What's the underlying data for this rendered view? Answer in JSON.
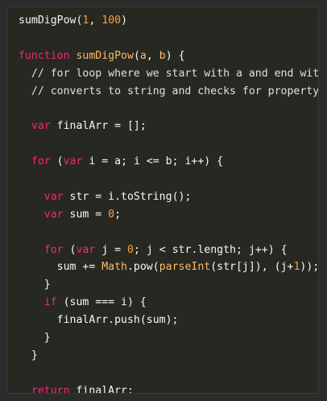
{
  "editor": {
    "colors": {
      "background": "#272822",
      "text": "#f8f8f2",
      "keyword": "#f92672",
      "function": "#ffb86c",
      "number": "#ff9d3c"
    },
    "lines": [
      [
        {
          "t": "sumDigPow(",
          "c": "plain"
        },
        {
          "t": "1",
          "c": "num"
        },
        {
          "t": ", ",
          "c": "plain"
        },
        {
          "t": "100",
          "c": "num"
        },
        {
          "t": ")",
          "c": "plain"
        }
      ],
      [],
      [
        {
          "t": "function ",
          "c": "kw"
        },
        {
          "t": "sumDigPow",
          "c": "fn"
        },
        {
          "t": "(",
          "c": "plain"
        },
        {
          "t": "a",
          "c": "fn"
        },
        {
          "t": ", ",
          "c": "plain"
        },
        {
          "t": "b",
          "c": "fn"
        },
        {
          "t": ") {",
          "c": "plain"
        }
      ],
      [
        {
          "t": "  // for loop where we start with a and end with b",
          "c": "cm"
        }
      ],
      [
        {
          "t": "  // converts to string and checks for property",
          "c": "cm"
        }
      ],
      [],
      [
        {
          "t": "  ",
          "c": "plain"
        },
        {
          "t": "var",
          "c": "kw"
        },
        {
          "t": " finalArr = [];",
          "c": "plain"
        }
      ],
      [],
      [
        {
          "t": "  ",
          "c": "plain"
        },
        {
          "t": "for",
          "c": "kw"
        },
        {
          "t": " (",
          "c": "plain"
        },
        {
          "t": "var",
          "c": "kw"
        },
        {
          "t": " i = a; i <= b; i++) {",
          "c": "plain"
        }
      ],
      [],
      [
        {
          "t": "    ",
          "c": "plain"
        },
        {
          "t": "var",
          "c": "kw"
        },
        {
          "t": " str = i.toString();",
          "c": "plain"
        }
      ],
      [
        {
          "t": "    ",
          "c": "plain"
        },
        {
          "t": "var",
          "c": "kw"
        },
        {
          "t": " sum = ",
          "c": "plain"
        },
        {
          "t": "0",
          "c": "num"
        },
        {
          "t": ";",
          "c": "plain"
        }
      ],
      [],
      [
        {
          "t": "    ",
          "c": "plain"
        },
        {
          "t": "for",
          "c": "kw"
        },
        {
          "t": " (",
          "c": "plain"
        },
        {
          "t": "var",
          "c": "kw"
        },
        {
          "t": " j = ",
          "c": "plain"
        },
        {
          "t": "0",
          "c": "num"
        },
        {
          "t": "; j < str.length; j++) {",
          "c": "plain"
        }
      ],
      [
        {
          "t": "      sum += ",
          "c": "plain"
        },
        {
          "t": "Math",
          "c": "builtin"
        },
        {
          "t": ".pow(",
          "c": "plain"
        },
        {
          "t": "parseInt",
          "c": "builtin"
        },
        {
          "t": "(str[j]), (j+",
          "c": "plain"
        },
        {
          "t": "1",
          "c": "num"
        },
        {
          "t": "));",
          "c": "plain"
        }
      ],
      [
        {
          "t": "    }",
          "c": "plain"
        }
      ],
      [
        {
          "t": "    ",
          "c": "plain"
        },
        {
          "t": "if",
          "c": "kw"
        },
        {
          "t": " (sum === i) {",
          "c": "plain"
        }
      ],
      [
        {
          "t": "      finalArr.push(sum);",
          "c": "plain"
        }
      ],
      [
        {
          "t": "    }",
          "c": "plain"
        }
      ],
      [
        {
          "t": "  }",
          "c": "plain"
        }
      ],
      [],
      [
        {
          "t": "  ",
          "c": "plain"
        },
        {
          "t": "return",
          "c": "kw"
        },
        {
          "t": " finalArr;",
          "c": "plain"
        }
      ],
      [
        {
          "t": "}",
          "c": "plain"
        }
      ]
    ]
  }
}
